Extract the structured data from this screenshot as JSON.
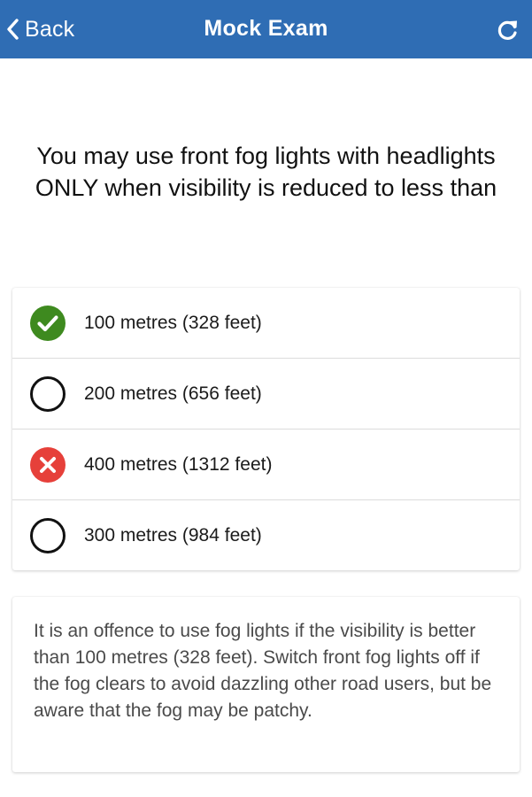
{
  "navbar": {
    "back_label": "Back",
    "title": "Mock Exam",
    "back_icon": "chevron-left-icon",
    "refresh_icon": "refresh-icon",
    "background_color": "#2f6db4"
  },
  "question": {
    "text": "You may use front fog lights with headlights ONLY when visibility is reduced to less than"
  },
  "options": [
    {
      "label": "100 metres (328 feet)",
      "state": "correct",
      "icon": "check-circle-icon",
      "color": "#3e8a1f"
    },
    {
      "label": "200 metres (656 feet)",
      "state": "unselected",
      "icon": "empty-circle-icon",
      "color": "#111111"
    },
    {
      "label": "400 metres (1312 feet)",
      "state": "wrong",
      "icon": "x-circle-icon",
      "color": "#e6403a"
    },
    {
      "label": "300 metres (984 feet)",
      "state": "unselected",
      "icon": "empty-circle-icon",
      "color": "#111111"
    }
  ],
  "explanation": {
    "text": "It is an offence to use fog lights if the visibility is better than 100 metres (328 feet). Switch front fog lights off if the fog clears to avoid dazzling other road users, but be aware that the fog may be patchy."
  }
}
